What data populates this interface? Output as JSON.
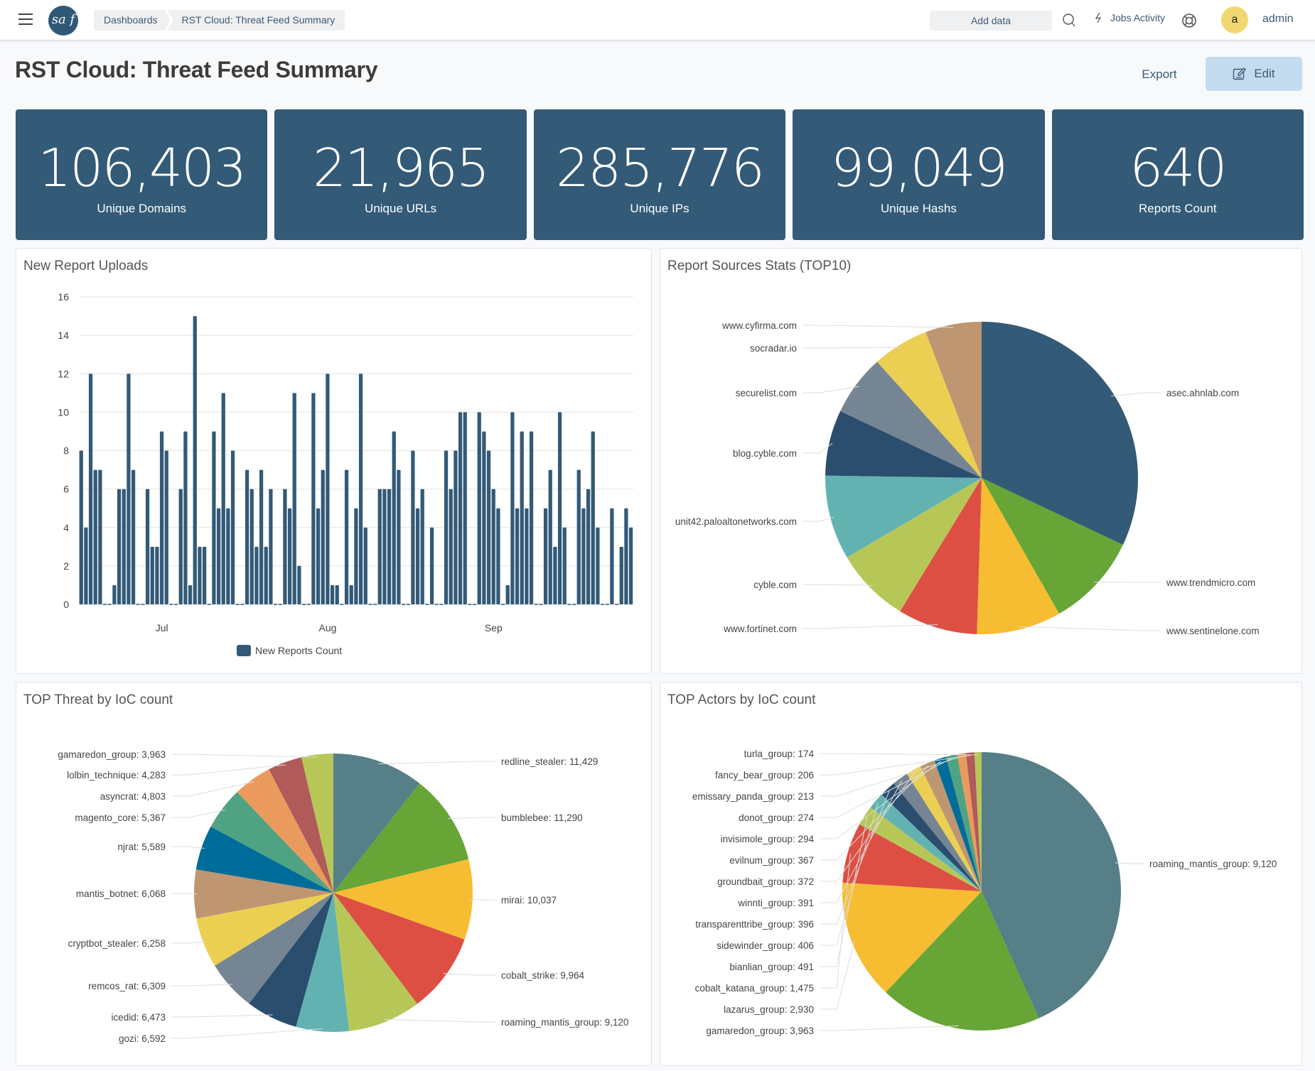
{
  "header": {
    "logo_text": "sa f",
    "breadcrumb": [
      "Dashboards",
      "RST Cloud: Threat Feed Summary"
    ],
    "add_data_label": "Add data",
    "jobs_label": "Jobs Activity",
    "avatar_letter": "a",
    "username": "admin"
  },
  "page": {
    "title": "RST Cloud: Threat Feed Summary",
    "export_label": "Export",
    "edit_label": "Edit"
  },
  "stats": [
    {
      "value": "106,403",
      "label": "Unique Domains"
    },
    {
      "value": "21,965",
      "label": "Unique URLs"
    },
    {
      "value": "285,776",
      "label": "Unique IPs"
    },
    {
      "value": "99,049",
      "label": "Unique Hashs"
    },
    {
      "value": "640",
      "label": "Reports Count"
    }
  ],
  "colors": {
    "stat_bg": "#335a77",
    "bar": "#335a77",
    "accent_button": "#c4dcf0"
  },
  "panels": {
    "bar_title": "New Report Uploads",
    "sources_title": "Report Sources Stats (TOP10)",
    "threats_title": "TOP Threat by IoC count",
    "actors_title": "TOP Actors by IoC count"
  },
  "chart_data": [
    {
      "type": "bar",
      "title": "New Report Uploads",
      "xlabel": "",
      "ylabel": "",
      "ylim": [
        0,
        16
      ],
      "yticks": [
        0,
        2,
        4,
        6,
        8,
        10,
        12,
        14,
        16
      ],
      "grid": true,
      "legend": "bottom",
      "month_ticks": [
        {
          "label": "Jul",
          "index": 17
        },
        {
          "label": "Aug",
          "index": 52
        },
        {
          "label": "Sep",
          "index": 87
        }
      ],
      "series": [
        {
          "name": "New Reports Count",
          "color": "#335a77",
          "values": [
            8,
            4,
            12,
            7,
            7,
            0,
            0,
            1,
            6,
            6,
            12,
            7,
            0,
            0,
            6,
            3,
            3,
            9,
            8,
            0,
            0,
            6,
            9,
            1,
            15,
            3,
            3,
            0,
            9,
            5,
            11,
            5,
            8,
            0,
            0,
            7,
            6,
            3,
            7,
            3,
            6,
            0,
            0,
            6,
            5,
            11,
            2,
            0,
            0,
            11,
            5,
            7,
            12,
            1,
            1,
            0,
            7,
            1,
            5,
            12,
            4,
            0,
            0,
            6,
            6,
            6,
            9,
            7,
            0,
            0,
            8,
            5,
            6,
            0,
            4,
            0,
            0,
            8,
            6,
            8,
            10,
            10,
            0,
            0,
            10,
            9,
            8,
            6,
            5,
            0,
            1,
            10,
            5,
            9,
            5,
            9,
            0,
            0,
            5,
            7,
            3,
            10,
            4,
            0,
            0,
            7,
            5,
            6,
            9,
            4,
            0,
            0,
            5,
            0,
            3,
            5,
            4
          ]
        }
      ]
    },
    {
      "type": "pie",
      "title": "Report Sources Stats (TOP10)",
      "slices": [
        {
          "label": "asec.ahnlab.com",
          "value": 33,
          "color": "#335a77"
        },
        {
          "label": "www.trendmicro.com",
          "value": 10,
          "color": "#67a536"
        },
        {
          "label": "www.sentinelone.com",
          "value": 9,
          "color": "#f6bd33"
        },
        {
          "label": "www.fortinet.com",
          "value": 8.5,
          "color": "#dd4f43"
        },
        {
          "label": "cyble.com",
          "value": 8,
          "color": "#b6c758"
        },
        {
          "label": "unit42.paloaltonetworks.com",
          "value": 9,
          "color": "#62b2b2"
        },
        {
          "label": "blog.cyble.com",
          "value": 7,
          "color": "#2b4e6e"
        },
        {
          "label": "securelist.com",
          "value": 6.5,
          "color": "#758593"
        },
        {
          "label": "socradar.io",
          "value": 6,
          "color": "#ebcf52"
        },
        {
          "label": "www.cyfirma.com",
          "value": 6,
          "color": "#be9671"
        }
      ]
    },
    {
      "type": "pie",
      "title": "TOP Threat by IoC count",
      "slices": [
        {
          "label": "redline_stealer",
          "value": 11429,
          "color": "#567f87"
        },
        {
          "label": "bumblebee",
          "value": 11290,
          "color": "#67a536"
        },
        {
          "label": "mirai",
          "value": 10037,
          "color": "#f6bd33"
        },
        {
          "label": "cobalt_strike",
          "value": 9964,
          "color": "#dd4f43"
        },
        {
          "label": "roaming_mantis_group",
          "value": 9120,
          "color": "#b6c758"
        },
        {
          "label": "gozi",
          "value": 6592,
          "color": "#62b2b2"
        },
        {
          "label": "icedid",
          "value": 6473,
          "color": "#2b4e6e"
        },
        {
          "label": "remcos_rat",
          "value": 6309,
          "color": "#758593"
        },
        {
          "label": "cryptbot_stealer",
          "value": 6258,
          "color": "#ebcf52"
        },
        {
          "label": "mantis_botnet",
          "value": 6068,
          "color": "#be9671"
        },
        {
          "label": "njrat",
          "value": 5589,
          "color": "#006c9a"
        },
        {
          "label": "magento_core",
          "value": 5367,
          "color": "#4fa382"
        },
        {
          "label": "asyncrat",
          "value": 4803,
          "color": "#eb9a5d"
        },
        {
          "label": "lolbin_technique",
          "value": 4283,
          "color": "#b05a5a"
        },
        {
          "label": "gamaredon_group",
          "value": 3963,
          "color": "#b6c758"
        }
      ]
    },
    {
      "type": "pie",
      "title": "TOP Actors by IoC count",
      "slices": [
        {
          "label": "roaming_mantis_group",
          "value": 9120,
          "color": "#567f87"
        },
        {
          "label": "gamaredon_group",
          "value": 3963,
          "color": "#67a536"
        },
        {
          "label": "lazarus_group",
          "value": 2930,
          "color": "#f6bd33"
        },
        {
          "label": "cobalt_katana_group",
          "value": 1475,
          "color": "#dd4f43"
        },
        {
          "label": "bianlian_group",
          "value": 491,
          "color": "#b6c758"
        },
        {
          "label": "sidewinder_group",
          "value": 406,
          "color": "#62b2b2"
        },
        {
          "label": "transparenttribe_group",
          "value": 396,
          "color": "#2b4e6e"
        },
        {
          "label": "winnti_group",
          "value": 391,
          "color": "#758593"
        },
        {
          "label": "groundbait_group",
          "value": 372,
          "color": "#ebcf52"
        },
        {
          "label": "evilnum_group",
          "value": 367,
          "color": "#be9671"
        },
        {
          "label": "invisimole_group",
          "value": 294,
          "color": "#006c9a"
        },
        {
          "label": "donot_group",
          "value": 274,
          "color": "#4fa382"
        },
        {
          "label": "emissary_panda_group",
          "value": 213,
          "color": "#eb9a5d"
        },
        {
          "label": "fancy_bear_group",
          "value": 206,
          "color": "#b05a5a"
        },
        {
          "label": "turla_group",
          "value": 174,
          "color": "#b6c758"
        }
      ]
    }
  ]
}
